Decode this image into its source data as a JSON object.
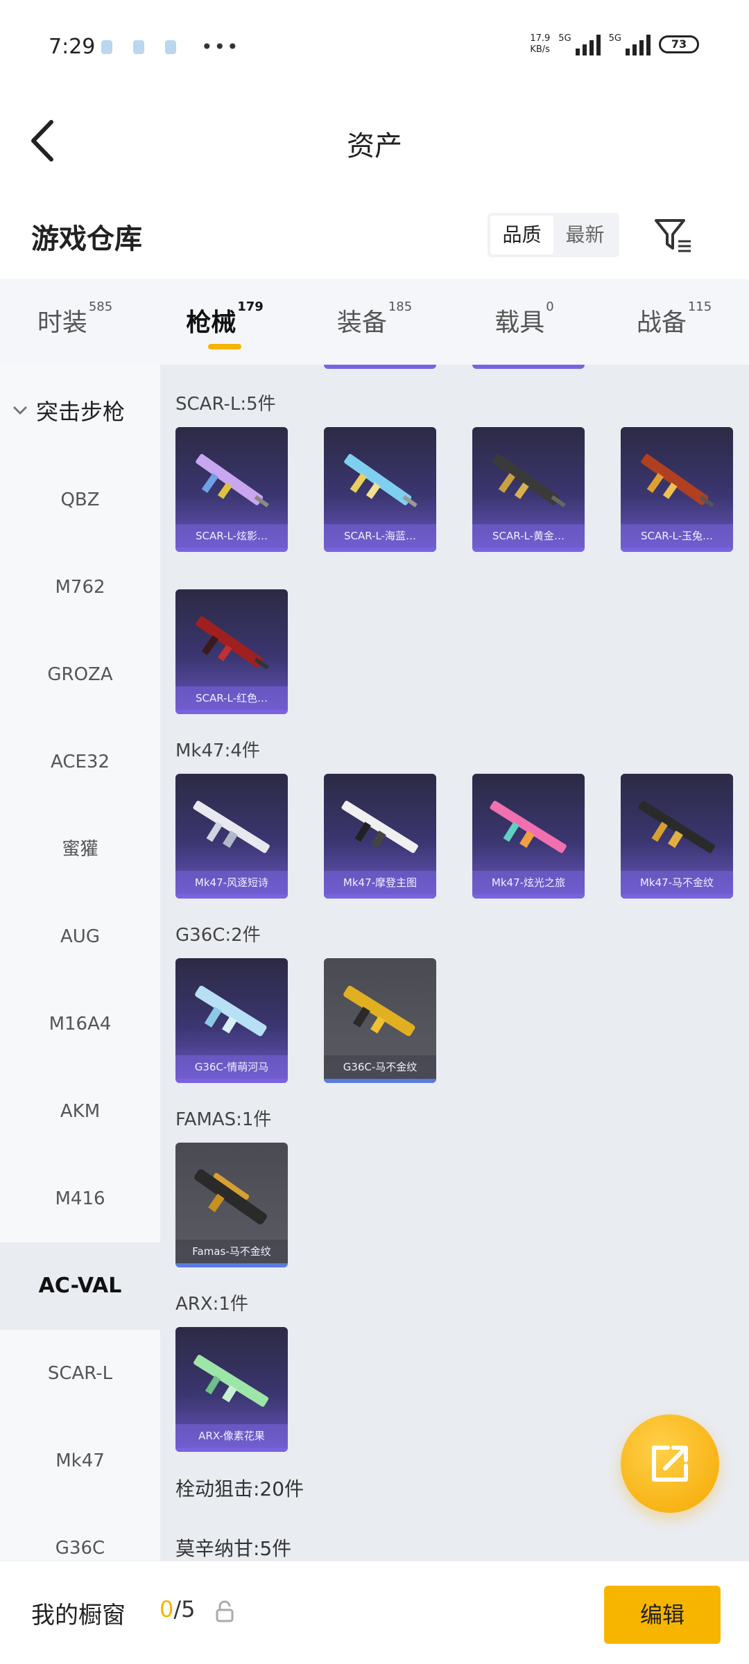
{
  "status": {
    "time": "7:29",
    "net_speed_top": "17.9",
    "net_speed_bottom": "KB/s",
    "sig1": "5G",
    "sig2": "5G",
    "battery": "73"
  },
  "header": {
    "title": "资产"
  },
  "warehouse": {
    "title": "游戏仓库",
    "sort_quality": "品质",
    "sort_newest": "最新"
  },
  "tabs": [
    {
      "label": "时装",
      "count": "585"
    },
    {
      "label": "枪械",
      "count": "179"
    },
    {
      "label": "装备",
      "count": "185"
    },
    {
      "label": "载具",
      "count": "0"
    },
    {
      "label": "战备",
      "count": "115"
    }
  ],
  "sidebar": {
    "group": "突击步枪",
    "items": [
      "QBZ",
      "M762",
      "GROZA",
      "ACE32",
      "蜜獾",
      "AUG",
      "M16A4",
      "AKM",
      "M416",
      "AC-VAL",
      "SCAR-L",
      "Mk47",
      "G36C"
    ]
  },
  "groups": {
    "scar": {
      "label": "SCAR-L:5件",
      "items": [
        "SCAR-L-炫影…",
        "SCAR-L-海蓝…",
        "SCAR-L-黄金…",
        "SCAR-L-玉兔…",
        "SCAR-L-红色…"
      ]
    },
    "mk47": {
      "label": "Mk47:4件",
      "items": [
        "Mk47-风逐短诗",
        "Mk47-摩登主图",
        "Mk47-炫光之旅",
        "Mk47-马不金纹"
      ]
    },
    "g36c": {
      "label": "G36C:2件",
      "items": [
        "G36C-情萌河马",
        "G36C-马不金纹"
      ]
    },
    "famas": {
      "label": "FAMAS:1件",
      "items": [
        "Famas-马不金纹"
      ]
    },
    "arx": {
      "label": "ARX:1件",
      "items": [
        "ARX-像素花果"
      ]
    },
    "sniper": {
      "label": "栓动狙击:20件"
    },
    "mosin": {
      "label": "莫辛纳甘:5件"
    }
  },
  "bottom": {
    "title": "我的橱窗",
    "count_current": "0",
    "count_total": "/5",
    "edit": "编辑"
  }
}
